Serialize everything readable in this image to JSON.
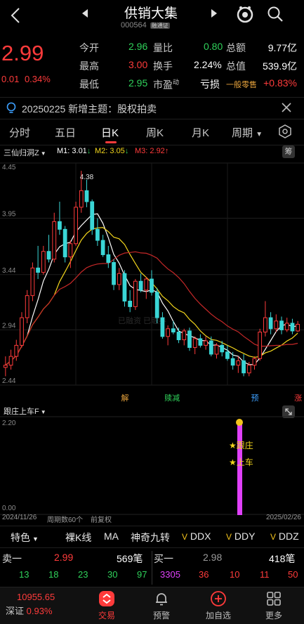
{
  "header": {
    "title": "供销大集",
    "code": "000564",
    "code_badge": "融通证"
  },
  "quote": {
    "price": "2.99",
    "change": "0.01",
    "change_pct": "0.34%",
    "rows": [
      {
        "l1": "今开",
        "v1": "2.96",
        "l2": "量比",
        "v2": "0.80",
        "l3": "总额",
        "v3": "9.77亿"
      },
      {
        "l1": "最高",
        "v1": "3.00",
        "l2": "换手",
        "v2": "2.24%",
        "l3": "总值",
        "v3": "539.9亿"
      },
      {
        "l1": "最低",
        "v1": "2.95",
        "l2": "市盈",
        "l2sup": "动",
        "v2": "亏损",
        "l3": "一般零售",
        "v3": "+0.83%"
      }
    ]
  },
  "notice": {
    "text": "20250225 新增主题：股权拍卖"
  },
  "tabs": [
    "分时",
    "五日",
    "日K",
    "周K",
    "月K",
    "周期"
  ],
  "indicator": {
    "name": "三仙归洞Z",
    "m1": "M1: 3.01",
    "m1_arrow": "↓",
    "m2": "M2: 3.05",
    "m2_arrow": "↓",
    "m3": "M3: 2.92",
    "m3_arrow": "↑",
    "chip": "筹"
  },
  "chart_data": {
    "type": "candlestick",
    "y_ticks": [
      "4.45",
      "3.95",
      "3.44",
      "2.94",
      "2.44"
    ],
    "ylim": [
      2.44,
      4.45
    ],
    "peak_label": "4.38",
    "watermark": "已融资\n已融券",
    "markers": [
      {
        "text": "解",
        "color": "#e6a23c",
        "x_index": 22
      },
      {
        "text": "赎减",
        "color": "#2fd15a",
        "x_index": 30
      },
      {
        "text": "预",
        "color": "#3da0ff",
        "x_index": 46
      },
      {
        "text": "涨",
        "color": "#ff3b3b",
        "x_index": 54
      }
    ],
    "candles": [
      [
        2.6,
        2.7,
        2.52,
        2.62
      ],
      [
        2.62,
        2.76,
        2.58,
        2.7
      ],
      [
        2.7,
        2.85,
        2.66,
        2.8
      ],
      [
        2.8,
        3.1,
        2.78,
        3.05
      ],
      [
        3.05,
        3.3,
        3.0,
        3.25
      ],
      [
        3.25,
        3.55,
        3.2,
        3.5
      ],
      [
        3.5,
        3.7,
        3.4,
        3.46
      ],
      [
        3.46,
        3.7,
        3.44,
        3.65
      ],
      [
        3.65,
        3.8,
        3.55,
        3.58
      ],
      [
        3.58,
        4.0,
        3.55,
        3.92
      ],
      [
        3.92,
        4.1,
        3.8,
        3.85
      ],
      [
        3.85,
        3.88,
        3.55,
        3.6
      ],
      [
        3.6,
        3.75,
        3.5,
        3.72
      ],
      [
        3.72,
        4.1,
        3.7,
        4.05
      ],
      [
        4.05,
        4.38,
        4.0,
        4.2
      ],
      [
        4.2,
        4.3,
        4.05,
        4.1
      ],
      [
        4.1,
        4.12,
        3.8,
        3.85
      ],
      [
        3.85,
        3.95,
        3.7,
        3.75
      ],
      [
        3.75,
        3.8,
        3.6,
        3.62
      ],
      [
        3.62,
        3.7,
        3.5,
        3.55
      ],
      [
        3.55,
        3.58,
        3.3,
        3.35
      ],
      [
        3.35,
        3.5,
        3.3,
        3.45
      ],
      [
        3.45,
        3.48,
        3.15,
        3.2
      ],
      [
        3.2,
        3.3,
        3.1,
        3.15
      ],
      [
        3.15,
        3.4,
        3.12,
        3.38
      ],
      [
        3.38,
        3.45,
        3.28,
        3.3
      ],
      [
        3.3,
        3.42,
        3.22,
        3.4
      ],
      [
        3.4,
        3.48,
        3.25,
        3.28
      ],
      [
        3.28,
        3.32,
        3.0,
        3.05
      ],
      [
        3.05,
        3.1,
        2.86,
        2.88
      ],
      [
        2.88,
        2.98,
        2.8,
        2.95
      ],
      [
        2.95,
        3.02,
        2.9,
        2.92
      ],
      [
        2.92,
        2.96,
        2.82,
        2.85
      ],
      [
        2.85,
        2.95,
        2.8,
        2.93
      ],
      [
        2.93,
        2.96,
        2.75,
        2.78
      ],
      [
        2.78,
        2.88,
        2.72,
        2.86
      ],
      [
        2.86,
        2.9,
        2.78,
        2.8
      ],
      [
        2.8,
        2.88,
        2.76,
        2.84
      ],
      [
        2.84,
        2.88,
        2.7,
        2.72
      ],
      [
        2.72,
        2.82,
        2.68,
        2.8
      ],
      [
        2.8,
        2.84,
        2.7,
        2.74
      ],
      [
        2.74,
        2.8,
        2.66,
        2.68
      ],
      [
        2.68,
        2.74,
        2.58,
        2.62
      ],
      [
        2.62,
        2.7,
        2.55,
        2.66
      ],
      [
        2.66,
        2.72,
        2.52,
        2.55
      ],
      [
        2.55,
        2.65,
        2.52,
        2.62
      ],
      [
        2.62,
        2.7,
        2.58,
        2.68
      ],
      [
        2.68,
        2.95,
        2.66,
        2.92
      ],
      [
        2.92,
        3.2,
        2.88,
        3.05
      ],
      [
        3.05,
        3.1,
        2.9,
        2.95
      ],
      [
        2.95,
        3.08,
        2.92,
        3.02
      ],
      [
        3.02,
        3.06,
        2.9,
        2.94
      ],
      [
        2.94,
        3.05,
        2.92,
        3.0
      ],
      [
        3.0,
        3.04,
        2.9,
        2.93
      ],
      [
        2.93,
        3.02,
        2.92,
        2.99
      ]
    ]
  },
  "sub_chart": {
    "name": "跟庄上车F",
    "y_top": "2.20",
    "y_bottom": "0.00",
    "label1": "★跟庄",
    "label2": "★上车"
  },
  "bottom_axis": {
    "start": "2024/11/26",
    "period": "周期数60个",
    "adj": "前复权",
    "end": "2025/02/26"
  },
  "toolbar": [
    "特色",
    "裸K线",
    "MA",
    "神奇九转",
    "DDX",
    "DDY",
    "DDZ"
  ],
  "orders": {
    "sell_label": "卖一",
    "sell_price": "2.99",
    "sell_vol": "569笔",
    "buy_label": "买一",
    "buy_price": "2.98",
    "buy_vol": "418笔",
    "sell_ticks": [
      "13",
      "18",
      "23",
      "30",
      "97"
    ],
    "buy_ticks": [
      "3305",
      "36",
      "10",
      "11",
      "50"
    ]
  },
  "nav": {
    "index_value": "10955.65",
    "index_name": "深证",
    "index_pct": "0.93%",
    "items": [
      "交易",
      "预警",
      "加自选",
      "更多"
    ]
  }
}
